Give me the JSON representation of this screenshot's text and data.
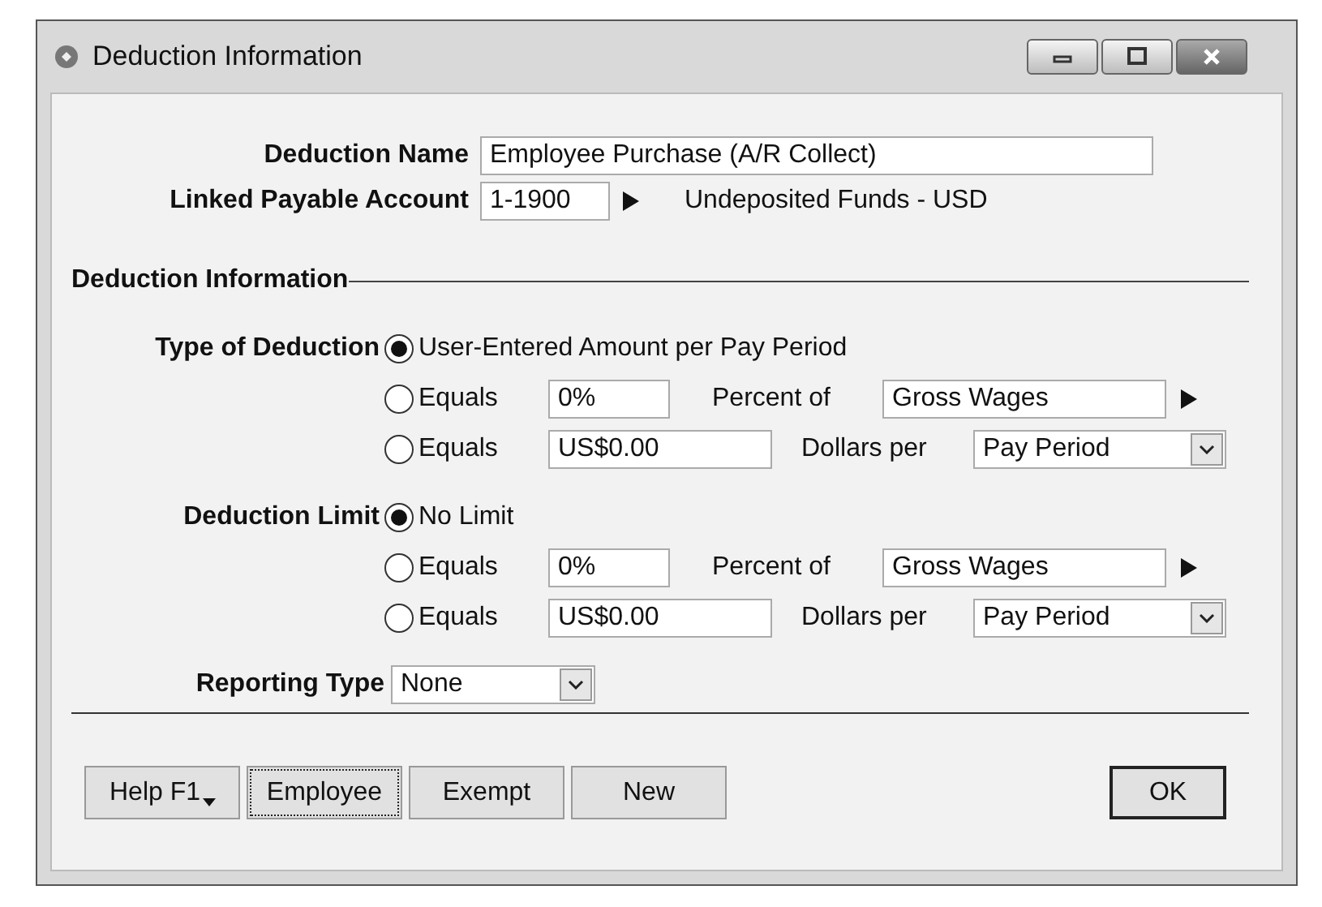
{
  "window": {
    "title": "Deduction Information"
  },
  "deduction_name": {
    "label": "Deduction Name",
    "value": "Employee Purchase (A/R Collect)"
  },
  "linked_account": {
    "label": "Linked Payable Account",
    "value": "1-1900",
    "description": "Undeposited Funds - USD"
  },
  "section_title": "Deduction Information",
  "groups": [
    {
      "label": "Type of Deduction",
      "options": [
        {
          "kind": "plain",
          "label": "User-Entered Amount per Pay Period",
          "selected": true
        },
        {
          "kind": "percent",
          "label": "Equals",
          "selected": false,
          "value": "0%",
          "unit_label": "Percent of",
          "base": "Gross Wages"
        },
        {
          "kind": "dollars",
          "label": "Equals",
          "selected": false,
          "value": "US$0.00",
          "unit_label": "Dollars per",
          "base": "Pay Period"
        }
      ]
    },
    {
      "label": "Deduction Limit",
      "options": [
        {
          "kind": "plain",
          "label": "No Limit",
          "selected": true
        },
        {
          "kind": "percent",
          "label": "Equals",
          "selected": false,
          "value": "0%",
          "unit_label": "Percent of",
          "base": "Gross Wages"
        },
        {
          "kind": "dollars",
          "label": "Equals",
          "selected": false,
          "value": "US$0.00",
          "unit_label": "Dollars per",
          "base": "Pay Period"
        }
      ]
    }
  ],
  "reporting_type": {
    "label": "Reporting Type",
    "value": "None"
  },
  "buttons": [
    {
      "label": "Help F1",
      "kind": "menu",
      "focused": false
    },
    {
      "label": "Employee",
      "kind": "plain",
      "focused": true
    },
    {
      "label": "Exempt",
      "kind": "plain",
      "focused": false
    },
    {
      "label": "New",
      "kind": "plain",
      "focused": false
    }
  ],
  "ok_button": {
    "label": "OK"
  }
}
